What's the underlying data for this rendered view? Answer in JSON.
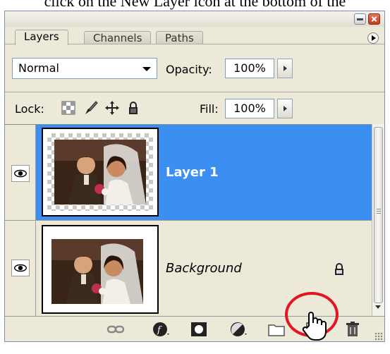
{
  "caption": "click on the New Layer icon at the bottom of the",
  "tabs": [
    {
      "label": "Layers",
      "active": true
    },
    {
      "label": "Channels",
      "active": false
    },
    {
      "label": "Paths",
      "active": false
    }
  ],
  "blend_mode": {
    "value": "Normal"
  },
  "opacity": {
    "label": "Opacity:",
    "value": "100%"
  },
  "lock": {
    "label": "Lock:",
    "icons": [
      "lock-transparent-pixels-icon",
      "lock-image-pixels-icon",
      "lock-position-icon",
      "lock-all-icon"
    ]
  },
  "fill": {
    "label": "Fill:",
    "value": "100%"
  },
  "layers": [
    {
      "name": "Layer 1",
      "selected": true,
      "visible": true,
      "transparent": true
    },
    {
      "name": "Background",
      "selected": false,
      "visible": true,
      "locked": true
    }
  ],
  "bottom_icons": [
    "link-layers-icon",
    "layer-style-icon",
    "layer-mask-icon",
    "adjustment-layer-icon",
    "new-group-folder-icon",
    "new-layer-icon",
    "trash-icon"
  ],
  "colors": {
    "selection": "#3b8ff0",
    "highlight_circle": "#e3161f",
    "panel_bg": "#ece9d8"
  }
}
